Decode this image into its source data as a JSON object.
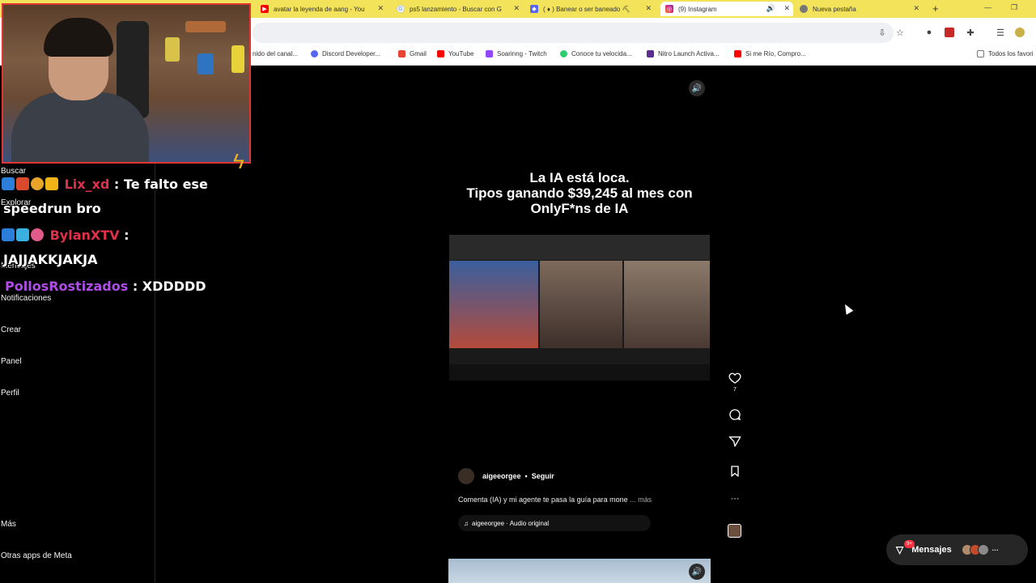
{
  "browser": {
    "tabs": [
      {
        "label": "avatar la leyenda de aang - You",
        "icon": "youtube-icon",
        "color": "#ff0000"
      },
      {
        "label": "ps5 lanzamiento - Buscar con G",
        "icon": "google-icon",
        "color": "#4285f4"
      },
      {
        "label": "( ♦ ) Banear o ser baneado ⛏",
        "icon": "discord-icon",
        "color": "#5865f2"
      },
      {
        "label": "(9) Instagram",
        "icon": "instagram-icon",
        "color": "#e1306c"
      },
      {
        "label": "Nueva pestaña",
        "icon": "chrome-icon",
        "color": "#777777"
      }
    ],
    "new_tab": "+",
    "bookmarks": [
      {
        "label": "nido del canal...",
        "color": "#ffffff"
      },
      {
        "label": "Discord Developer...",
        "color": "#5865f2"
      },
      {
        "label": "Gmail",
        "color": "#ea4335"
      },
      {
        "label": "YouTube",
        "color": "#ff0000"
      },
      {
        "label": "Soarinng - Twitch",
        "color": "#9146ff"
      },
      {
        "label": "Conoce tu velocida...",
        "color": "#2ecc71"
      },
      {
        "label": "Nitro Launch Activa...",
        "color": "#5c2d91"
      },
      {
        "label": "Si me Río, Compro...",
        "color": "#ff0000"
      },
      {
        "label": "Todos los favori",
        "color": "#777777"
      }
    ]
  },
  "sidebar": {
    "items": [
      "Buscar",
      "Explorar",
      "Mensajes",
      "Notificaciones",
      "Crear",
      "Panel",
      "Perfil",
      "Más",
      "Otras apps de Meta"
    ]
  },
  "chat": {
    "messages": [
      {
        "user": "Lix_xd",
        "sep": " : ",
        "text": "Te falto ese"
      },
      {
        "continuation": "speedrun bro"
      },
      {
        "user": "BylanXTV",
        "sep": " :"
      },
      {
        "continuation": "JAJJAKKJAKJA"
      },
      {
        "user": "PollosRostizados",
        "sep": " : ",
        "text": "XDDDDD"
      }
    ]
  },
  "reel": {
    "overlay_lines": [
      "La IA está loca.",
      "Tipos ganando $39,245 al mes con",
      "OnlyF*ns de IA"
    ],
    "likes": "7",
    "author": "aigeeorgee",
    "follow": "Seguir",
    "dot": "•",
    "caption": "Comenta (IA) y mi agente te pasa la guía para mone",
    "more": "... más",
    "audio": "aigeeorgee · Audio original",
    "more_options": "···"
  },
  "messages_pill": {
    "label": "Mensajes",
    "badge": "9+",
    "overflow": "···"
  },
  "colors": {
    "tabstrip": "#f2e35a",
    "webcam_border": "#e03535",
    "username_red": "#e0314b",
    "username_purple": "#b04ce8",
    "notification": "#ff3040"
  }
}
